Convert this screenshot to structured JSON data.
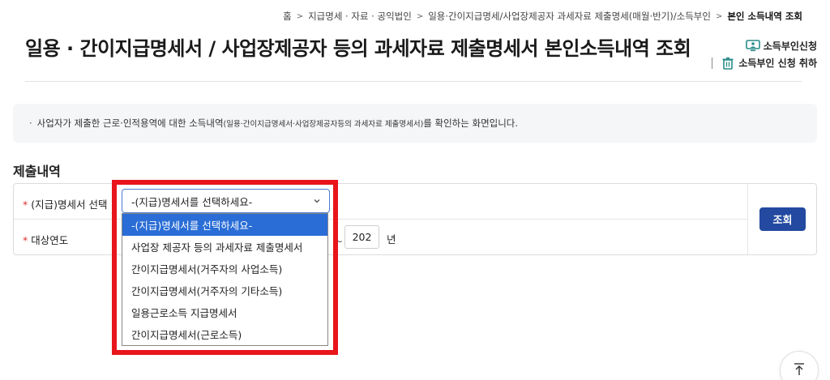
{
  "breadcrumb": [
    "홈",
    "지급명세 · 자료 · 공익법인",
    "일용·간이지급명세/사업장제공자 과세자료 제출명세(매월·반기)/소득부인",
    "본인 소득내역 조회"
  ],
  "page_title": "일용 · 간이지급명세서 / 사업장제공자 등의 과세자료 제출명세서 본인소득내역 조회",
  "side_links": {
    "income_deny_apply": "소득부인신청",
    "income_deny_cancel": "소득부인 신청 취하"
  },
  "info": {
    "text_main": "사업자가 제출한 근로·인적용역에 대한 소득내역",
    "text_small": "(일용·간이지급명세서·사업장제공자등의 과세자료 제출명세서)",
    "text_tail": "를 확인하는 화면입니다."
  },
  "section_title": "제출내역",
  "form": {
    "statement_label": "(지급)명세서 선택",
    "year_label": "대상연도",
    "required_mark": "*",
    "select_value": "-(지급)명세서를 선택하세요-",
    "options": [
      "-(지급)명세서를 선택하세요-",
      "사업장 제공자 등의 과세자료 제출명세서",
      "간이지급명세서(거주자의 사업소득)",
      "간이지급명세서(거주자의 기타소득)",
      "일용근로소득 지급명세서",
      "간이지급명세서(근로소득)"
    ],
    "selected_index": 0,
    "year_prefix": "~",
    "year_value": "202",
    "year_unit": "년",
    "search_label": "조회"
  },
  "colors": {
    "accent": "#234aa0",
    "selected_option": "#2a6dd6",
    "highlight_box": "#e8151b",
    "required": "#e03030"
  }
}
